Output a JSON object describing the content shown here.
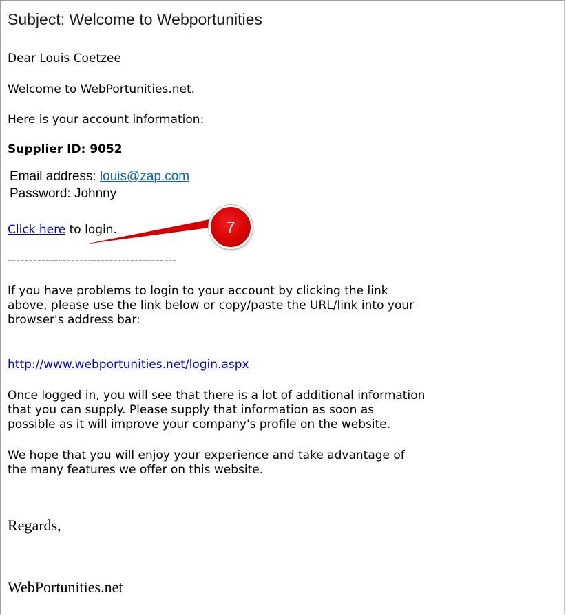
{
  "email": {
    "subject": "Subject: Welcome to Webportunities",
    "greeting": "Dear Louis Coetzee",
    "welcome": "Welcome to WebPortunities.net.",
    "intro": "Here is your account information:",
    "supplier_id_label": "Supplier ID: 9052",
    "email_label": "Email address: ",
    "email_value": "louis@zap.com",
    "password_label": "Password: Johnny",
    "click_here": "Click here",
    "to_login": " to login.",
    "separator": "----------------------------------------",
    "problems_text": [
      "If you have problems to login to your account by clicking the link",
      "above, please use the link below or copy/paste the URL/link into your",
      "browser's address bar:"
    ],
    "login_url": "http://www.webportunities.net/login.aspx",
    "additional_info": [
      "Once logged in, you will see that there is a lot of additional information",
      "that you can supply. Please supply that information as soon as",
      "possible as it will improve your company's profile on the website."
    ],
    "closing": [
      "We hope that you will enjoy your experience and take advantage of",
      "the many features we offer on this website."
    ],
    "regards": "Regards,",
    "signature": "WebPortunities.net"
  },
  "annotation": {
    "step_number": "7",
    "color": "#d40000"
  }
}
